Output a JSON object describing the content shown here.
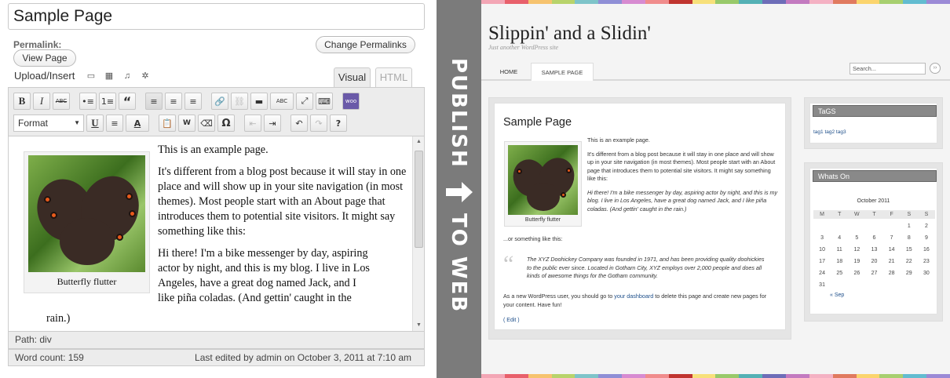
{
  "editor": {
    "post_title": "Sample Page",
    "permalink_label": "Permalink:",
    "change_permalinks_label": "Change Permalinks",
    "view_page_label": "View Page",
    "upload_insert_label": "Upload/Insert",
    "tabs": {
      "visual": "Visual",
      "html": "HTML"
    },
    "toolbar": {
      "format_select": "Format",
      "row1": [
        "B",
        "I",
        "ABC",
        "•≡",
        "1≡",
        "“",
        "≡",
        "≡",
        "≡",
        "🔗",
        "⛓",
        "▬",
        "ABC",
        "⤢",
        "⌨",
        "woo"
      ],
      "row2": [
        "U",
        "≡",
        "A",
        "📋",
        "W",
        "⌫",
        "Ω",
        "⇤",
        "⇥",
        "↶",
        "↷",
        "?"
      ]
    },
    "content": {
      "caption": "Butterfly flutter",
      "paragraphs": [
        "This is an example page.",
        "It's different from a blog post because it will stay in one place and will show up in your site navigation (in most themes). Most people start with an About page that introduces them to potential site visitors. It might say something like this:",
        "Hi there! I'm a bike messenger by day, aspiring actor by night, and this is my blog. I live in Los Angeles, have a great dog named Jack, and I like piña coladas. (And gettin' caught in the"
      ],
      "rain": "rain.)"
    },
    "path": "Path: div",
    "word_count": "Word count: 159",
    "last_edited": "Last edited by admin on October 3, 2011 at 7:10 am"
  },
  "banner": {
    "word1": "PUBLISH",
    "word2": "TO WEB",
    "arrow": "arrow-right-icon"
  },
  "site": {
    "title": "Slippin' and a Slidin'",
    "tagline": "Just another WordPress site",
    "nav": [
      "HOME",
      "SAMPLE PAGE"
    ],
    "search_placeholder": "Search...",
    "post": {
      "title": "Sample Page",
      "caption": "Butterfly flutter",
      "p1": "This is an example page.",
      "p2": "It's different from a blog post because it will stay in one place and will show up in your site navigation (in most themes). Most people start with an About page that introduces them to potential site visitors. It might say something like this:",
      "p3": "Hi there! I'm a bike messenger by day, aspiring actor by night, and this is my blog. I live in Los Angeles, have a great dog named Jack, and I like piña coladas. (And gettin' caught in the rain.)",
      "or": "...or something like this:",
      "quote": "The XYZ Doohickey Company was founded in 1971, and has been providing quality doohickies to the public ever since. Located in Gotham City, XYZ employs over 2,000 people and does all kinds of awesome things for the Gotham community.",
      "foot_pre": "As a new WordPress user, you should go to ",
      "foot_link": "your dashboard",
      "foot_post": " to delete this page and create new pages for your content. Have fun!",
      "edit": "( Edit )"
    },
    "tags_widget": {
      "title": "TaGS",
      "tags": "tag1 tag2 tag3"
    },
    "calendar": {
      "title": "Whats On",
      "caption": "October 2011",
      "days": [
        "M",
        "T",
        "W",
        "T",
        "F",
        "S",
        "S"
      ],
      "cells": [
        "",
        "",
        "",
        "",
        "",
        "1",
        "2",
        "3",
        "4",
        "5",
        "6",
        "7",
        "8",
        "9",
        "10",
        "11",
        "12",
        "13",
        "14",
        "15",
        "16",
        "17",
        "18",
        "19",
        "20",
        "21",
        "22",
        "23",
        "24",
        "25",
        "26",
        "27",
        "28",
        "29",
        "30",
        "31",
        "",
        "",
        "",
        "",
        "",
        ""
      ],
      "prev": "« Sep"
    },
    "stripe_colors": [
      "#f3a6b5",
      "#e8606b",
      "#f6c36e",
      "#b8d36b",
      "#7ec4c9",
      "#8f8fd6",
      "#d78bd1",
      "#f08c8c",
      "#c0342f",
      "#f7e07a",
      "#98c96a",
      "#54b1b5",
      "#6d6db8",
      "#c37ac0",
      "#f4b1c3",
      "#e07a5f",
      "#fbd46d",
      "#a7cf6f",
      "#62bcd0",
      "#9b8ad6"
    ]
  }
}
